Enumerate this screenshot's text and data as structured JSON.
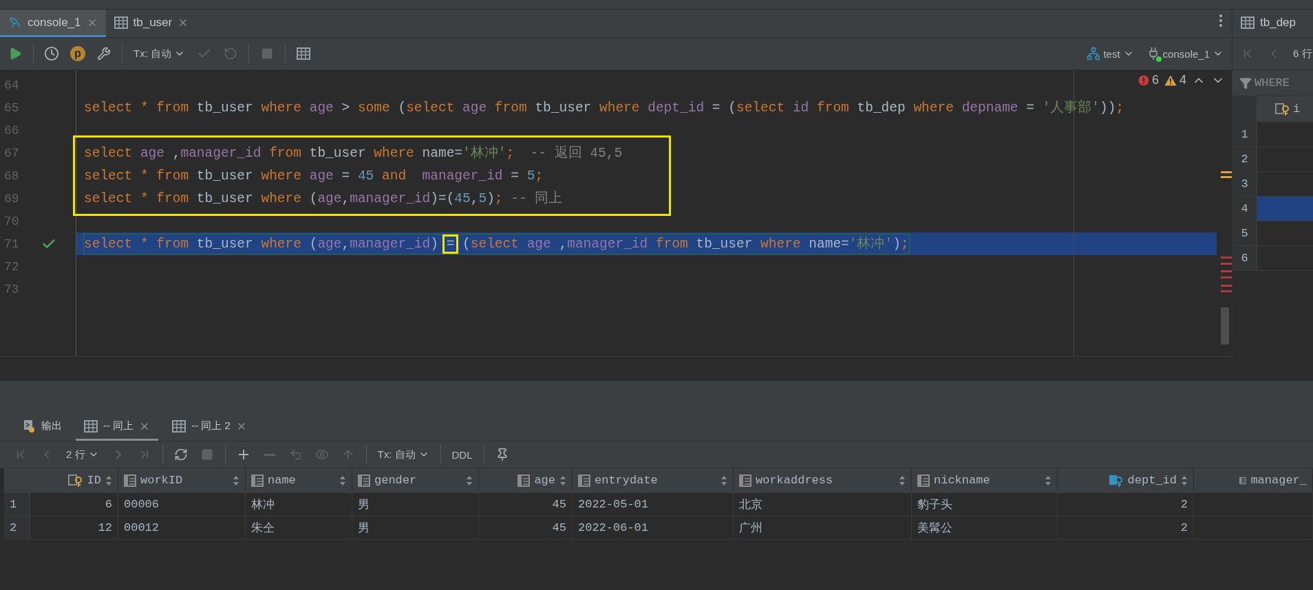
{
  "editor_tabs": [
    {
      "label": "console_1",
      "kind": "console",
      "selected": true
    },
    {
      "label": "tb_user",
      "kind": "table",
      "selected": false
    }
  ],
  "toolbar": {
    "profile_badge": "p",
    "tx_mode": "Tx: 自动",
    "commit_disabled": true,
    "rollback_disabled": true,
    "stop_disabled": true,
    "data_source": "test",
    "session": "console_1",
    "session_connected": true
  },
  "inspections": {
    "errors": "6",
    "warnings": "4"
  },
  "code_lines": [
    {
      "number": "64",
      "boxed": false,
      "selected": false,
      "executed": false
    },
    {
      "number": "65",
      "boxed": false,
      "selected": false,
      "executed": false,
      "tokens": [
        {
          "kind": "kw",
          "text": "select "
        },
        {
          "kind": "kw",
          "text": "* "
        },
        {
          "kind": "kw",
          "text": "from "
        },
        {
          "kind": "plain",
          "text": "tb_user "
        },
        {
          "kind": "kw",
          "text": "where "
        },
        {
          "kind": "col",
          "text": "age "
        },
        {
          "kind": "plain",
          "text": "> "
        },
        {
          "kind": "kw",
          "text": "some "
        },
        {
          "kind": "plain",
          "text": "("
        },
        {
          "kind": "kw",
          "text": "select "
        },
        {
          "kind": "col",
          "text": "age "
        },
        {
          "kind": "kw",
          "text": "from "
        },
        {
          "kind": "plain",
          "text": "tb_user "
        },
        {
          "kind": "kw",
          "text": "where "
        },
        {
          "kind": "col",
          "text": "dept_id "
        },
        {
          "kind": "plain",
          "text": "= ("
        },
        {
          "kind": "kw",
          "text": "select "
        },
        {
          "kind": "col",
          "text": "id "
        },
        {
          "kind": "kw",
          "text": "from "
        },
        {
          "kind": "plain",
          "text": "tb_dep "
        },
        {
          "kind": "kw",
          "text": "where "
        },
        {
          "kind": "col",
          "text": "depname "
        },
        {
          "kind": "plain",
          "text": "= "
        },
        {
          "kind": "str",
          "text": "'人事部'"
        },
        {
          "kind": "plain",
          "text": "))"
        },
        {
          "kind": "semi",
          "text": ";"
        }
      ]
    },
    {
      "number": "66",
      "boxed": false,
      "selected": false,
      "executed": false
    },
    {
      "number": "67",
      "boxed": true,
      "selected": false,
      "executed": false,
      "tokens": [
        {
          "kind": "kw",
          "text": "select "
        },
        {
          "kind": "col",
          "text": "age "
        },
        {
          "kind": "plain",
          "text": ","
        },
        {
          "kind": "col",
          "text": "manager_id "
        },
        {
          "kind": "kw",
          "text": "from "
        },
        {
          "kind": "plain",
          "text": "tb_user "
        },
        {
          "kind": "kw",
          "text": "where "
        },
        {
          "kind": "plain",
          "text": "name="
        },
        {
          "kind": "str",
          "text": "'林冲'"
        },
        {
          "kind": "semi",
          "text": ";  "
        },
        {
          "kind": "cmt",
          "text": "-- 返回 45,5"
        }
      ]
    },
    {
      "number": "68",
      "boxed": true,
      "selected": false,
      "executed": false,
      "tokens": [
        {
          "kind": "kw",
          "text": "select "
        },
        {
          "kind": "kw",
          "text": "* "
        },
        {
          "kind": "kw",
          "text": "from "
        },
        {
          "kind": "plain",
          "text": "tb_user "
        },
        {
          "kind": "kw",
          "text": "where "
        },
        {
          "kind": "col",
          "text": "age "
        },
        {
          "kind": "plain",
          "text": "= "
        },
        {
          "kind": "num",
          "text": "45 "
        },
        {
          "kind": "kw",
          "text": "and  "
        },
        {
          "kind": "col",
          "text": "manager_id "
        },
        {
          "kind": "plain",
          "text": "= "
        },
        {
          "kind": "num",
          "text": "5"
        },
        {
          "kind": "semi",
          "text": ";"
        }
      ]
    },
    {
      "number": "69",
      "boxed": true,
      "selected": false,
      "executed": false,
      "tokens": [
        {
          "kind": "kw",
          "text": "select "
        },
        {
          "kind": "kw",
          "text": "* "
        },
        {
          "kind": "kw",
          "text": "from "
        },
        {
          "kind": "plain",
          "text": "tb_user "
        },
        {
          "kind": "kw",
          "text": "where "
        },
        {
          "kind": "plain",
          "text": "("
        },
        {
          "kind": "col",
          "text": "age"
        },
        {
          "kind": "plain",
          "text": ","
        },
        {
          "kind": "col",
          "text": "manager_id"
        },
        {
          "kind": "plain",
          "text": ")=("
        },
        {
          "kind": "num",
          "text": "45"
        },
        {
          "kind": "plain",
          "text": ","
        },
        {
          "kind": "num",
          "text": "5"
        },
        {
          "kind": "plain",
          "text": ")"
        },
        {
          "kind": "semi",
          "text": "; "
        },
        {
          "kind": "cmt",
          "text": "-- 同上"
        }
      ]
    },
    {
      "number": "70",
      "boxed": false,
      "selected": false,
      "executed": false
    },
    {
      "number": "71",
      "boxed": false,
      "selected": true,
      "executed": true,
      "tokens": [
        {
          "kind": "kw",
          "text": "select "
        },
        {
          "kind": "kw",
          "text": "* "
        },
        {
          "kind": "kw",
          "text": "from "
        },
        {
          "kind": "plain",
          "text": "tb_user "
        },
        {
          "kind": "kw",
          "text": "where "
        },
        {
          "kind": "plain",
          "text": "("
        },
        {
          "kind": "col",
          "text": "age"
        },
        {
          "kind": "plain",
          "text": ","
        },
        {
          "kind": "col",
          "text": "manager_id"
        },
        {
          "kind": "plain",
          "text": ") "
        },
        {
          "kind": "boxed",
          "text": "="
        },
        {
          "kind": "plain",
          "text": " ("
        },
        {
          "kind": "kw",
          "text": "select "
        },
        {
          "kind": "col",
          "text": "age "
        },
        {
          "kind": "plain",
          "text": ","
        },
        {
          "kind": "col",
          "text": "manager_id "
        },
        {
          "kind": "kw",
          "text": "from "
        },
        {
          "kind": "plain",
          "text": "tb_user "
        },
        {
          "kind": "kw",
          "text": "where "
        },
        {
          "kind": "plain",
          "text": "name="
        },
        {
          "kind": "str",
          "text": "'林冲'"
        },
        {
          "kind": "plain",
          "text": ")"
        },
        {
          "kind": "semi",
          "text": ";"
        }
      ]
    },
    {
      "number": "72",
      "boxed": false,
      "selected": false,
      "executed": false
    },
    {
      "number": "73",
      "boxed": false,
      "selected": false,
      "executed": false
    }
  ],
  "side_panel": {
    "tab": "tb_dep",
    "row_count": "6 行",
    "filter": "WHERE",
    "column_header": "i",
    "rows": [
      {
        "number": "1",
        "selected": false
      },
      {
        "number": "2",
        "selected": false
      },
      {
        "number": "3",
        "selected": false
      },
      {
        "number": "4",
        "selected": true
      },
      {
        "number": "5",
        "selected": false
      },
      {
        "number": "6",
        "selected": false
      }
    ]
  },
  "result_tabs": [
    {
      "label": "输出",
      "kind": "output",
      "selected": false,
      "closable": false
    },
    {
      "label": "-- 同上",
      "kind": "table",
      "selected": true,
      "closable": true
    },
    {
      "label": "-- 同上 2",
      "kind": "table",
      "selected": false,
      "closable": true
    }
  ],
  "result_toolbar": {
    "row_count": "2 行",
    "tx_mode": "Tx: 自动",
    "ddl": "DDL",
    "navigation_disabled": true,
    "stop_disabled": true,
    "delete_disabled": true,
    "revert_disabled": true,
    "preview_disabled": true,
    "submit_disabled": true
  },
  "result_table": {
    "columns": [
      "ID",
      "workID",
      "name",
      "gender",
      "age",
      "entrydate",
      "workaddress",
      "nickname",
      "dept_id",
      "manager_"
    ],
    "rows": [
      {
        "number": "1",
        "cells": [
          "6",
          "00006",
          "林冲",
          "男",
          "45",
          "2022-05-01",
          "北京",
          "豹子头",
          "2"
        ]
      },
      {
        "number": "2",
        "cells": [
          "12",
          "00012",
          "朱仝",
          "男",
          "45",
          "2022-06-01",
          "广州",
          "美髯公",
          "2"
        ]
      }
    ]
  }
}
